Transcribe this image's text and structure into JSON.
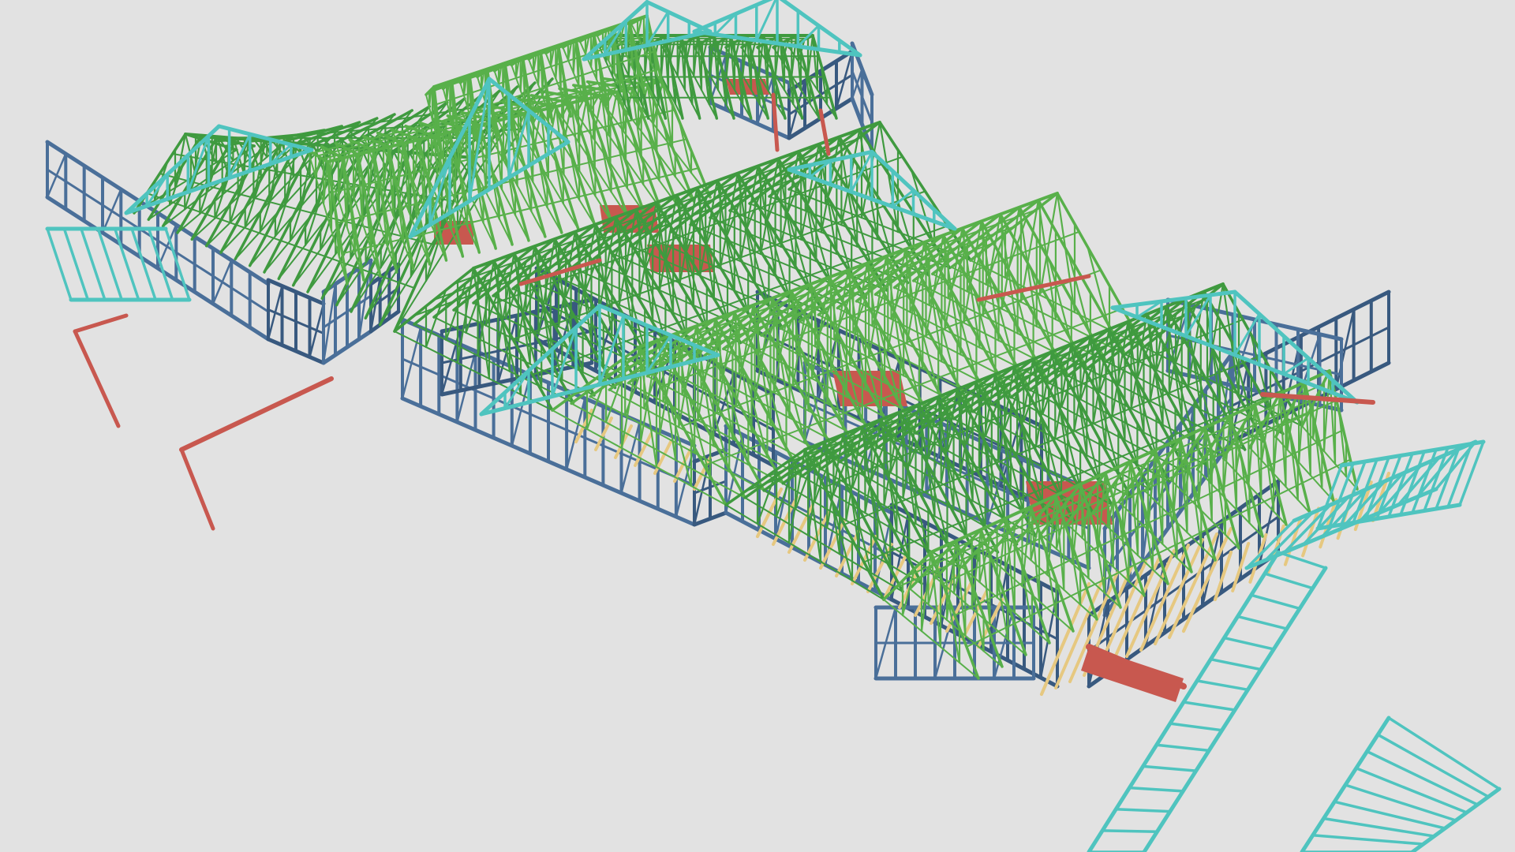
{
  "scene": {
    "subject": "steel-frame-building-model",
    "background_color": "#e2e2e2",
    "colors": {
      "roof_trusses": "#3f9a3f",
      "roof_truss_light": "#58b04a",
      "wall_frames": "#4a6f99",
      "wall_frames_dark": "#38597f",
      "gable_frames": "#4fc4bf",
      "ceiling_joists": "#e6c880",
      "beams": "#c8584f",
      "floor_panels": "#c8584f"
    }
  }
}
